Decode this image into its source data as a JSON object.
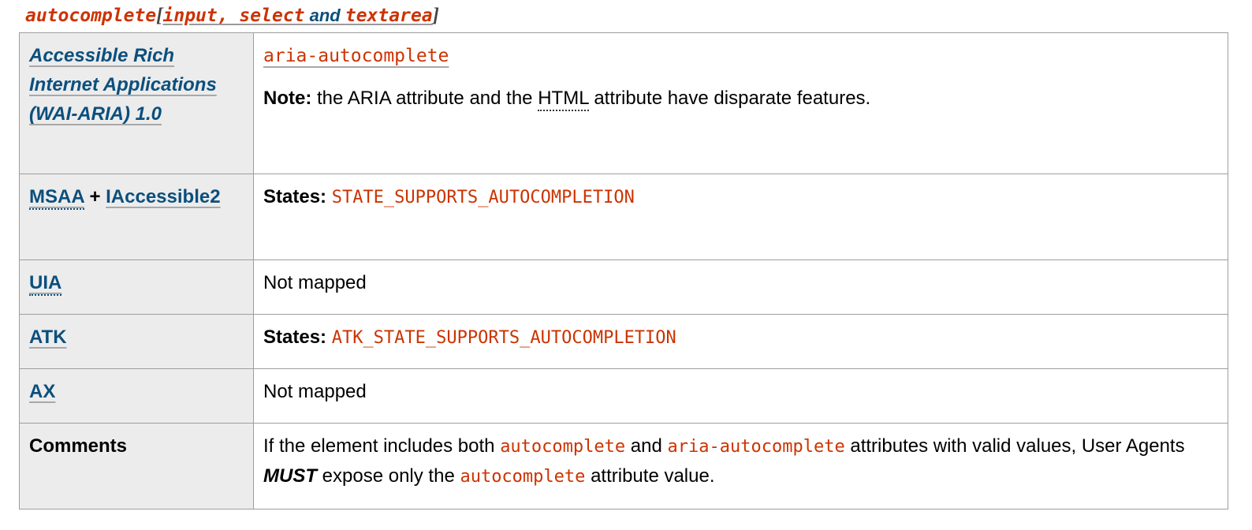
{
  "caption": {
    "attribute": "autocomplete",
    "open_bracket": "[",
    "elements_1": "input, select",
    "conjunction": " and ",
    "elements_2": "textarea",
    "close_bracket": "]"
  },
  "colors": {
    "code_red": "#cc3300",
    "link_blue": "#0b4f7d",
    "header_bg": "#ececec",
    "border": "#9e9e9e"
  },
  "table": {
    "rows": [
      {
        "header": "Accessible Rich Internet Applications (WAI-ARIA) 1.0",
        "header_is_link": true,
        "code_link": "aria-autocomplete",
        "note_label": "Note:",
        "note_text_1": " the ARIA attribute and the ",
        "note_abbr": "HTML",
        "note_text_2": " attribute have disparate features."
      },
      {
        "header_abbr": "MSAA",
        "header_plus": " + ",
        "header_link2": "IAccessible2",
        "label": "States:",
        "value": "STATE_SUPPORTS_AUTOCOMPLETION"
      },
      {
        "header": "UIA",
        "value": "Not mapped"
      },
      {
        "header": "ATK",
        "label": "States:",
        "value": "ATK_STATE_SUPPORTS_AUTOCOMPLETION"
      },
      {
        "header": "AX",
        "value": "Not mapped"
      },
      {
        "header": "Comments",
        "text_1": "If the element includes both ",
        "code_1": "autocomplete",
        "text_2": " and ",
        "code_2": "aria-autocomplete",
        "text_3": " attributes with valid values, User Agents ",
        "must": "MUST",
        "text_4": " expose only the ",
        "code_3": "autocomplete",
        "text_5": " attribute value."
      }
    ]
  }
}
